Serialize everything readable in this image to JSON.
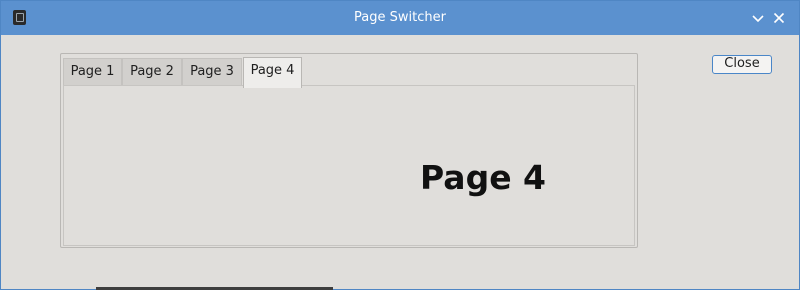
{
  "window": {
    "title": "Page Switcher"
  },
  "titlebar": {
    "app_icon": "document-icon",
    "minimize_icon": "chevron-down-icon",
    "close_icon": "close-icon"
  },
  "tabs": [
    {
      "label": "Page 1",
      "active": false
    },
    {
      "label": "Page 2",
      "active": false
    },
    {
      "label": "Page 3",
      "active": false
    },
    {
      "label": "Page 4",
      "active": true
    }
  ],
  "content": {
    "label": "Page 4"
  },
  "buttons": {
    "close_label": "Close"
  },
  "colors": {
    "titlebar": "#5b91cf",
    "window_bg": "#e0dedb",
    "accent": "#4a86c8"
  }
}
